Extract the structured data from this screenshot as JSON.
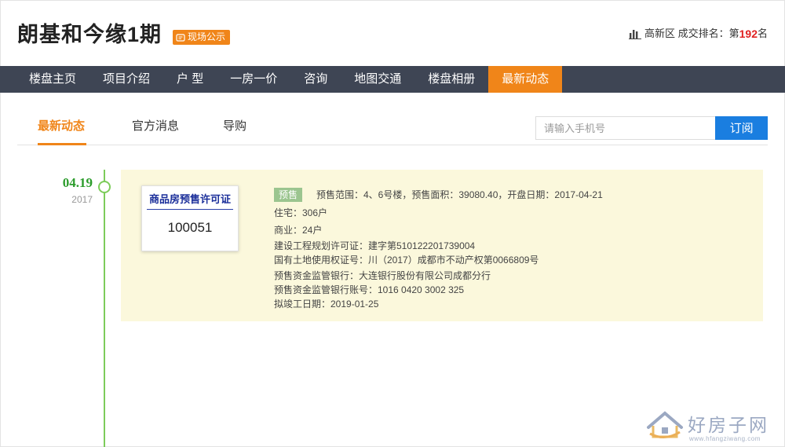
{
  "header": {
    "project_title": "朗基和今缘1期",
    "onsite_badge": "现场公示",
    "rank_prefix": "高新区 成交排名：第",
    "rank_number": "192",
    "rank_suffix": "名"
  },
  "nav": {
    "items": [
      {
        "label": "楼盘主页",
        "active": false
      },
      {
        "label": "项目介绍",
        "active": false
      },
      {
        "label": "户 型",
        "active": false
      },
      {
        "label": "一房一价",
        "active": false
      },
      {
        "label": "咨询",
        "active": false
      },
      {
        "label": "地图交通",
        "active": false
      },
      {
        "label": "楼盘相册",
        "active": false
      },
      {
        "label": "最新动态",
        "active": true
      }
    ]
  },
  "subtabs": {
    "items": [
      {
        "label": "最新动态",
        "active": true
      },
      {
        "label": "官方消息",
        "active": false
      },
      {
        "label": "导购",
        "active": false
      }
    ],
    "phone_placeholder": "请输入手机号",
    "subscribe_label": "订阅"
  },
  "timeline": {
    "event": {
      "date": "04.19",
      "year": "2017",
      "permit_title": "商品房预售许可证",
      "permit_number": "100051",
      "tag": "预售",
      "details": [
        "预售范围：4、6号楼，预售面积：39080.40，开盘日期：2017-04-21",
        "住宅：306户",
        "商业：24户",
        "建设工程规划许可证：建字第510122201739004",
        "国有土地使用权证号：川（2017）成都市不动产权第0066809号",
        "预售资金监管银行：大连银行股份有限公司成都分行",
        "预售资金监管银行账号：1016 0420 3002 325",
        "拟竣工日期：2019-01-25"
      ]
    }
  },
  "watermark": {
    "brand": "好房子网",
    "url": "www.hfangziwang.com"
  },
  "colors": {
    "accent_orange": "#f08519",
    "nav_background": "#3e4554",
    "subscribe_blue": "#1a7ee0",
    "timeline_green": "#7dcc5a",
    "date_green": "#2c9c2c",
    "card_background": "#fbf8dc",
    "rank_red": "#e02222"
  }
}
